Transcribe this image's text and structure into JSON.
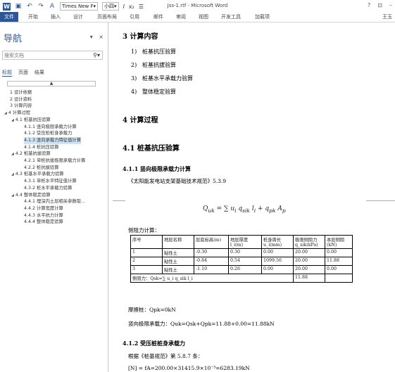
{
  "titlebar": {
    "font_name": "Times New F",
    "font_size": "小四",
    "doc_title": "Jss-1.rtf - Microsoft Word",
    "help": "?",
    "restore": "⊡",
    "minimize": "–"
  },
  "ribbon": {
    "tabs": [
      "文件",
      "开始",
      "插入",
      "设计",
      "页面布局",
      "引用",
      "邮件",
      "审阅",
      "视图",
      "开发工具",
      "加载项"
    ],
    "user": "王玉"
  },
  "nav": {
    "title": "导航",
    "search_placeholder": "搜索文档",
    "tabs": [
      "标题",
      "页面",
      "结果"
    ],
    "tree": [
      {
        "label": "1 设计依据",
        "level": 0,
        "toggle": ""
      },
      {
        "label": "2 设计资料",
        "level": 0,
        "toggle": ""
      },
      {
        "label": "3 计算内容",
        "level": 0,
        "toggle": ""
      },
      {
        "label": "4 计算过程",
        "level": 0,
        "toggle": "◢"
      },
      {
        "label": "4.1 桩基抗压验算",
        "level": 1,
        "toggle": "◢"
      },
      {
        "label": "4.1.1 竖向极限承载力计算",
        "level": 2,
        "toggle": ""
      },
      {
        "label": "4.1.2 受压桩桩身承载力",
        "level": 2,
        "toggle": ""
      },
      {
        "label": "4.1.3 竖向承载力特征值计算",
        "level": 2,
        "toggle": "",
        "selected": true
      },
      {
        "label": "4.1.4 桩抗压验算",
        "level": 2,
        "toggle": ""
      },
      {
        "label": "4.2 桩基抗拔验算",
        "level": 1,
        "toggle": "◢"
      },
      {
        "label": "4.2.1 单桩抗拔极限承载力计算",
        "level": 2,
        "toggle": ""
      },
      {
        "label": "4.2.2 桩抗拔验算",
        "level": 2,
        "toggle": ""
      },
      {
        "label": "4.3 桩基水平承载力验算",
        "level": 1,
        "toggle": "◢"
      },
      {
        "label": "4.3.1 单桩水平特征值计算",
        "level": 2,
        "toggle": ""
      },
      {
        "label": "4.3.2 桩水平承载力验算",
        "level": 2,
        "toggle": ""
      },
      {
        "label": "4.4 整体稳定验算",
        "level": 1,
        "toggle": "◢"
      },
      {
        "label": "4.4.1 埋深内土层相关参数取...",
        "level": 2,
        "toggle": ""
      },
      {
        "label": "4.4.2 计算宽度计算",
        "level": 2,
        "toggle": ""
      },
      {
        "label": "4.4.3 水平抗力计算",
        "level": 2,
        "toggle": ""
      },
      {
        "label": "4.4.4 整体稳定验算",
        "level": 2,
        "toggle": ""
      }
    ]
  },
  "doc": {
    "h_section3": "3 计算内容",
    "list": [
      {
        "n": "1)",
        "text": "桩基抗压验算"
      },
      {
        "n": "2)",
        "text": "桩基抗拔验算"
      },
      {
        "n": "3)",
        "text": "桩基水平承载力验算"
      },
      {
        "n": "4)",
        "text": "整体稳定验算"
      }
    ],
    "h_section4": "4 计算过程",
    "h_41": "4.1  桩基抗压验算",
    "h_411": "4.1.1   竖向极限承载力计算",
    "ref1": "《太阳能发电站支架基础技术规范》5.3.9",
    "formula": "Q_uk = Σ u_i q_sik l_i + q_pk A_p",
    "side_resist": "侧阻力计算：",
    "table": {
      "headers": [
        "序号",
        "地层名称",
        "层底标高(m)",
        "地层厚度l_i(m)",
        "桩身周长u_i(mm)",
        "极限侧阻力q_sik(kPa)",
        "本层侧阻(kN)"
      ],
      "rows": [
        [
          "1",
          "粘性土",
          "-0.30",
          "0.30",
          "0.00",
          "20.00",
          "0.00"
        ],
        [
          "2",
          "粘性土",
          "-0.84",
          "0.54",
          "1099.56",
          "20.00",
          "11.88"
        ],
        [
          "3",
          "粘性土",
          "-1.10",
          "0.26",
          "0.00",
          "20.00",
          "0.00"
        ]
      ],
      "sum_label": "侧阻力：Qsk=∑ u_i q_sik l_i",
      "sum_value": "11.88"
    },
    "friction": "摩擦桩：Qpk=0kN",
    "vertical": "竖向极限承载力：Quk=Qsk+Qpk=11.88+0.00=11.88kN",
    "h_412": "4.1.2   受压桩桩身承载力",
    "ref2": "根据《桩基规范》第 5.8.7 条：",
    "eq_n": "[N] = fA=200.00×31415.9×10⁻³=6283.19kN"
  }
}
